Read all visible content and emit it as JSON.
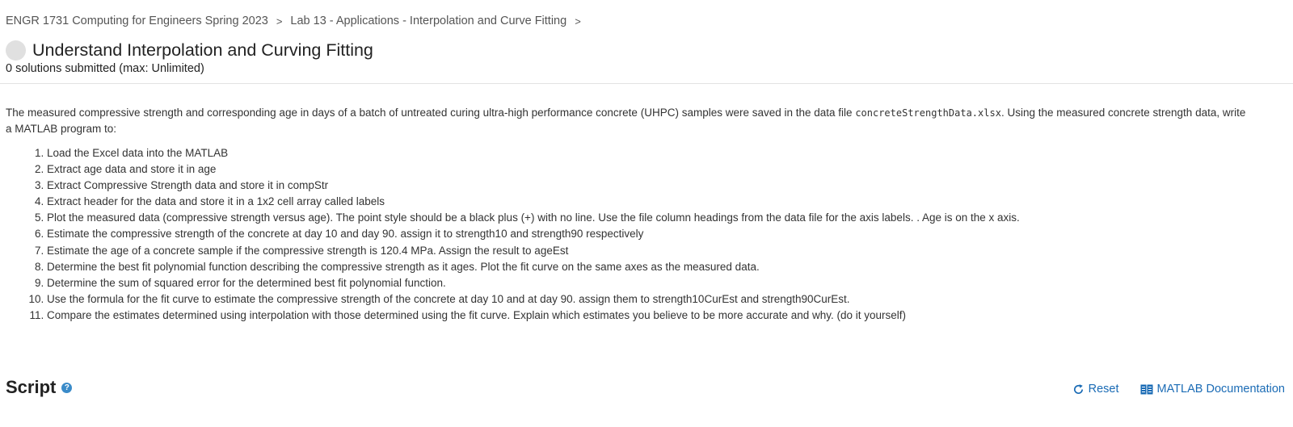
{
  "breadcrumb": {
    "items": [
      {
        "label": "ENGR 1731 Computing for Engineers Spring 2023"
      },
      {
        "label": "Lab 13 - Applications - Interpolation and Curve Fitting"
      }
    ],
    "separator": ">"
  },
  "problem": {
    "title": "Understand Interpolation and Curving Fitting",
    "submissions": "0 solutions submitted (max: Unlimited)"
  },
  "description": {
    "intro_before_file": "The measured compressive strength and corresponding age in days of a batch of untreated curing ultra-high performance concrete (UHPC) samples were saved in the data file ",
    "file_name": "concreteStrengthData.xlsx",
    "intro_after_file": ". Using the measured concrete strength data, write a MATLAB program to:",
    "steps": [
      "Load the Excel data into the MATLAB",
      "Extract age data and store it in age",
      "Extract Compressive Strength data and store it in compStr",
      "Extract header for the data and store it in a 1x2 cell array called labels",
      "Plot the measured data (compressive strength versus age). The point style should be a black plus (+) with no line. Use the file column headings from the data file for the axis labels. . Age is on the x axis.",
      "Estimate the compressive strength of the concrete at day 10 and day 90. assign it to strength10 and strength90 respectively",
      "Estimate the age of a concrete sample if the compressive strength is 120.4 MPa. Assign the result to ageEst",
      "Determine the best fit polynomial function describing the compressive strength as it ages. Plot the fit curve on the same axes as the measured data.",
      "Determine the sum of squared error for the determined best fit polynomial function.",
      "Use the formula for the fit curve to estimate the compressive strength of the concrete at day 10 and at day 90. assign them to strength10CurEst and strength90CurEst.",
      "Compare the estimates determined using interpolation with those determined using the fit curve. Explain which estimates you believe to be more accurate and why. (do it yourself)"
    ]
  },
  "script": {
    "heading": "Script",
    "help_icon": "?",
    "reset_label": "Reset",
    "docs_label": "MATLAB Documentation"
  },
  "colors": {
    "link": "#1a6bb5",
    "help_icon": "#3a8bc9",
    "status_circle": "#e0e0e0"
  }
}
